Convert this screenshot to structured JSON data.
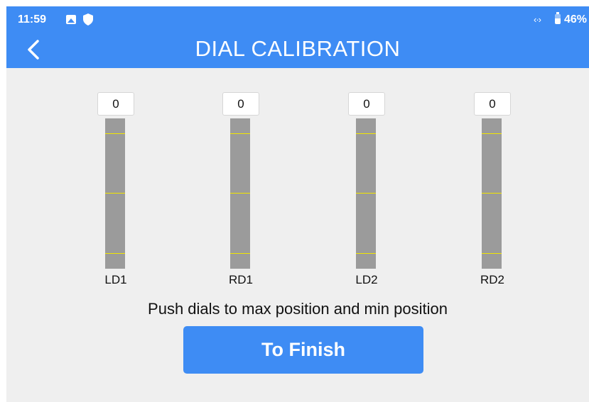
{
  "status_bar": {
    "time": "11:59",
    "battery": "46%",
    "icons": [
      "image-icon",
      "shield-icon",
      "data-transfer-icon",
      "battery-icon"
    ]
  },
  "header": {
    "title": "DIAL CALIBRATION",
    "back_icon": "chevron-left-icon"
  },
  "dials": [
    {
      "label": "LD1",
      "value": "0"
    },
    {
      "label": "RD1",
      "value": "0"
    },
    {
      "label": "LD2",
      "value": "0"
    },
    {
      "label": "RD2",
      "value": "0"
    }
  ],
  "instruction": "Push dials to max position and min position",
  "finish_button": "To Finish",
  "colors": {
    "accent": "#3e8cf4",
    "background": "#efefef",
    "track": "#9b9b9b",
    "marker": "#f2e600"
  }
}
